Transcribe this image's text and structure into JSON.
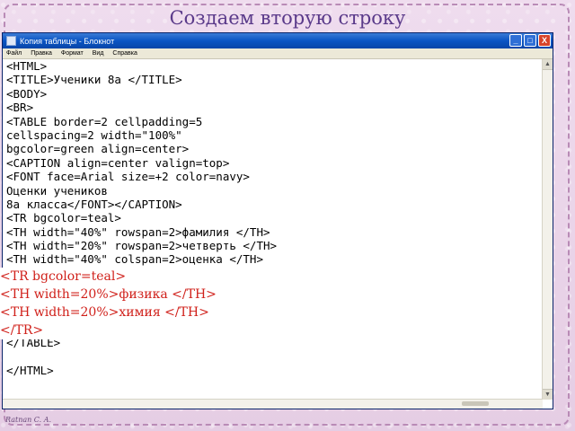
{
  "slide": {
    "title": "Создаем вторую строку",
    "signature": "Ratnan C. A."
  },
  "window": {
    "title": "Копия таблицы - Блокнот",
    "controls": [
      "_",
      "□",
      "X"
    ],
    "menu": [
      "Файл",
      "Правка",
      "Формат",
      "Вид",
      "Справка"
    ]
  },
  "code_lines": [
    "<HTML>",
    "<TITLE>Ученики 8a </TITLE>",
    "<BODY>",
    "<BR>",
    "<TABLE border=2 cellpadding=5",
    "cellspacing=2 width=\"100%\"",
    "bgcolor=green align=center>",
    "<CAPTION align=center valign=top>",
    "<FONT face=Arial size=+2 color=navy>",
    "Оценки учеников",
    "8а класса</FONT></CAPTION>",
    "<TR bgcolor=teal>",
    "<TH width=\"40%\" rowspan=2>фамилия </TH>",
    "<TH width=\"20%\" rowspan=2>четверть </TH>",
    "<TH width=\"40%\" colspan=2>оценка </TH>",
    "</TR>",
    "",
    "",
    "",
    "",
    "</TABLE>",
    "",
    "</HTML>"
  ],
  "overlay_lines": [
    "<TR bgcolor=teal>",
    "<TH width=20%>физика </TH>",
    "<TH width=20%>химия </TH>",
    "</TR>"
  ],
  "colors": {
    "overlay_text": "#d0201a",
    "title_text": "#5a3a8a",
    "titlebar": "#0a55c4"
  }
}
